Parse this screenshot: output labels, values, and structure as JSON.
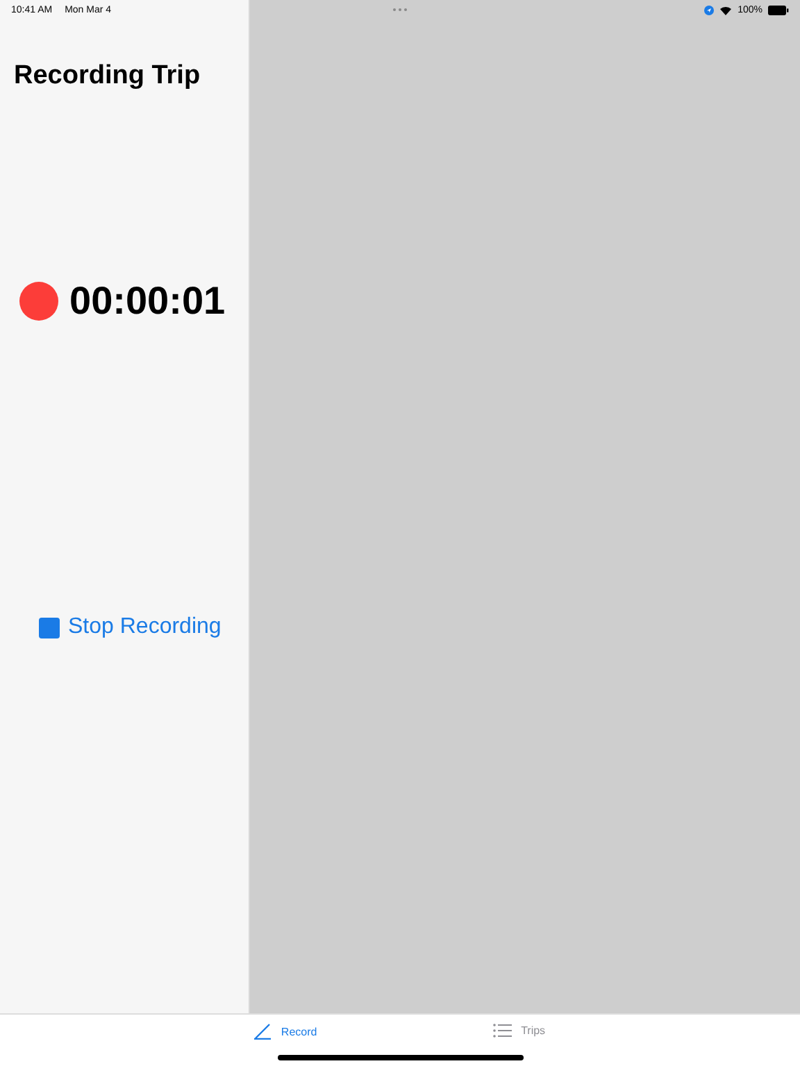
{
  "status_bar": {
    "time": "10:41 AM",
    "date": "Mon Mar 4",
    "battery": "100%"
  },
  "sidebar": {
    "title": "Recording Trip",
    "recording": true,
    "timer": "00:00:01",
    "stop_button": "Stop Recording"
  },
  "tabs": [
    {
      "label": "Record",
      "kind": "pencil",
      "selected": true
    },
    {
      "label": "Trips",
      "kind": "list",
      "selected": false
    }
  ]
}
